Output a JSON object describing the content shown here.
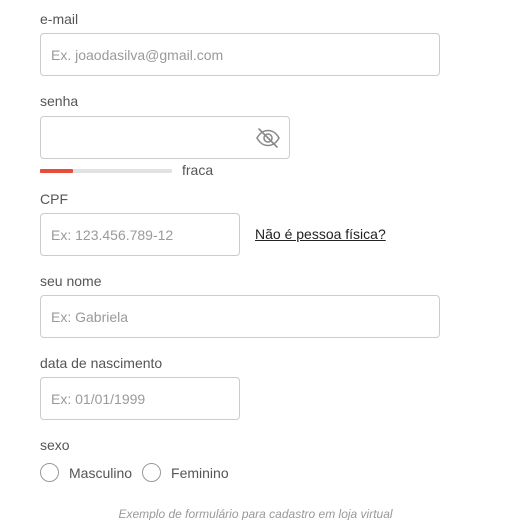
{
  "email": {
    "label": "e-mail",
    "value": "",
    "placeholder": "Ex. joaodasilva@gmail.com"
  },
  "password": {
    "label": "senha",
    "value": "",
    "placeholder": "",
    "toggle_icon": "eye-slash-icon",
    "strength": {
      "label": "fraca",
      "level": 0.25,
      "color": "#e74c3c"
    }
  },
  "cpf": {
    "label": "CPF",
    "value": "",
    "placeholder": "Ex: 123.456.789-12",
    "alt_link": "Não é pessoa física?"
  },
  "name": {
    "label": "seu nome",
    "value": "",
    "placeholder": "Ex: Gabriela"
  },
  "birthdate": {
    "label": "data de nascimento",
    "value": "",
    "placeholder": "Ex: 01/01/1999"
  },
  "sex": {
    "label": "sexo",
    "options": [
      "Masculino",
      "Feminino"
    ],
    "selected": null
  },
  "footer_text": "Exemplo de formulário para cadastro em loja virtual"
}
